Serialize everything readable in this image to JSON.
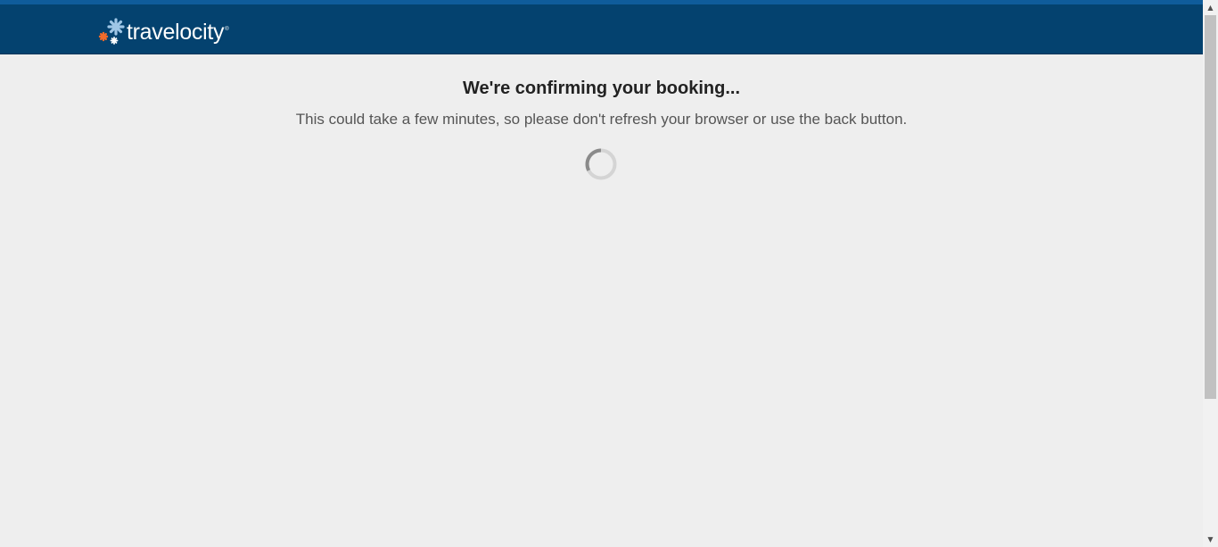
{
  "header": {
    "logo_text": "travelocity",
    "logo_trademark": "®",
    "logo_icon": "travelocity-star-icon",
    "brand_color": "#04426f",
    "accent_color": "#f26b2a"
  },
  "main": {
    "title": "We're confirming your booking...",
    "subtitle": "This could take a few minutes, so please don't refresh your browser or use the back button.",
    "spinner_icon": "loading-spinner-icon"
  },
  "scrollbar": {
    "up_arrow": "▲",
    "down_arrow": "▼"
  }
}
